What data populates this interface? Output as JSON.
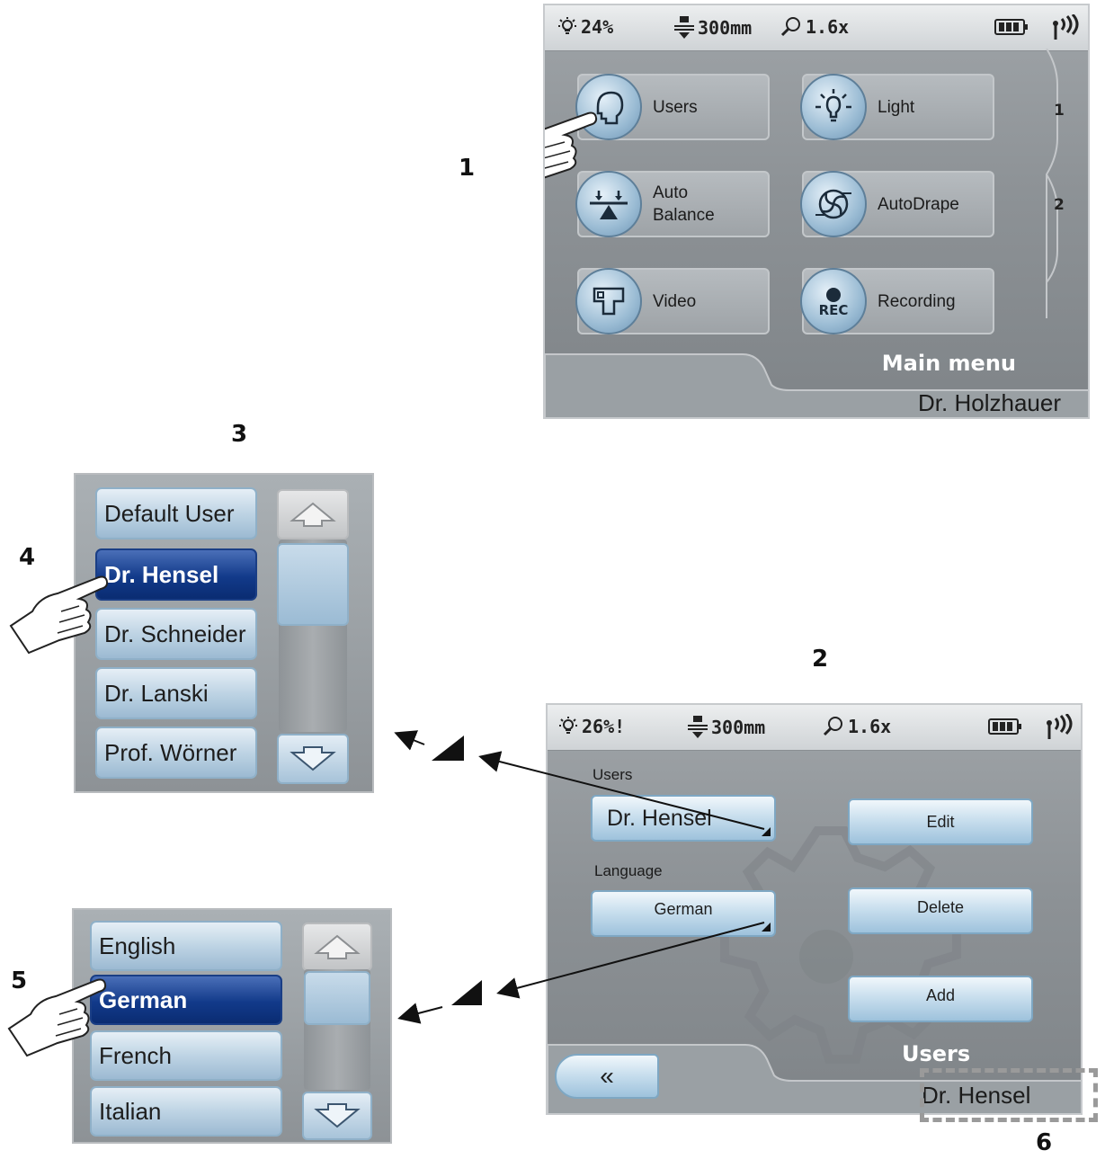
{
  "steps": [
    "1",
    "2",
    "3",
    "4",
    "5",
    "6"
  ],
  "status1": {
    "light": "24%",
    "distance": "300mm",
    "zoom": "1.6x"
  },
  "status2": {
    "light": "26%!",
    "distance": "300mm",
    "zoom": "1.6x"
  },
  "main_menu": {
    "tiles": [
      {
        "label": "Users",
        "icon": "head-icon"
      },
      {
        "label": "Light",
        "icon": "bulb-icon"
      },
      {
        "label": "Auto\nBalance",
        "icon": "balance-icon"
      },
      {
        "label": "AutoDrape",
        "icon": "drape-icon"
      },
      {
        "label": "Video",
        "icon": "video-icon"
      },
      {
        "label": "Recording",
        "icon": "rec-icon"
      }
    ],
    "rec_text": "REC",
    "tabs": [
      "1",
      "2"
    ],
    "title": "Main menu",
    "user": "Dr. Holzhauer"
  },
  "users_screen": {
    "users_label": "Users",
    "user_value": "Dr. Hensel",
    "language_label": "Language",
    "language_value": "German",
    "edit": "Edit",
    "delete": "Delete",
    "add": "Add",
    "back": "«",
    "title": "Users",
    "user": "Dr. Hensel"
  },
  "user_list": [
    "Default User",
    "Dr. Hensel",
    "Dr. Schneider",
    "Dr. Lanski",
    "Prof. Wörner"
  ],
  "user_list_selected": "Dr. Hensel",
  "language_list": [
    "English",
    "German",
    "French",
    "Italian"
  ],
  "language_list_selected": "German"
}
